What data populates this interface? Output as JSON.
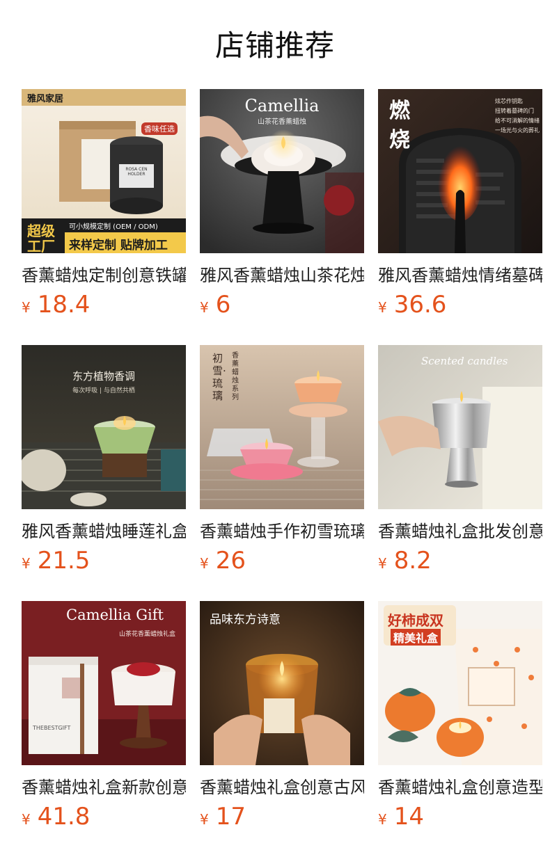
{
  "header": {
    "title": "店铺推荐"
  },
  "products": [
    {
      "name": "香薰蜡烛定制创意铁罐",
      "currency": "¥",
      "price": "18.4",
      "img_text": {
        "brand": "雅风家居",
        "tag": "香味任选",
        "line1": "可小规模定制 (OEM / ODM)",
        "badge1": "超级",
        "badge2": "工厂",
        "banner": "来样定制 贴牌加工",
        "label": "ROSA CEN HOLDER"
      }
    },
    {
      "name": "雅风香薰蜡烛山茶花烛台",
      "currency": "¥",
      "price": "6",
      "img_text": {
        "title": "Camellia",
        "sub": "山茶花香薰蜡烛"
      }
    },
    {
      "name": "雅风香薰蜡烛情绪墓碑",
      "currency": "¥",
      "price": "36.6",
      "img_text": {
        "big1": "燃",
        "big2": "烧",
        "l1": "炫芯作钥匙",
        "l2": "扭转着墓碑的门",
        "l3": "给不可消解的情绪",
        "l4": "一场光与火的葬礼"
      }
    },
    {
      "name": "雅风香薰蜡烛睡莲礼盒",
      "currency": "¥",
      "price": "21.5",
      "img_text": {
        "top": "东方植物香调",
        "sub": "每次呼吸 | 与自然共栖"
      }
    },
    {
      "name": "香薰蜡烛手作初雪琉璃",
      "currency": "¥",
      "price": "26",
      "img_text": {
        "v1": "初雪·琉璃",
        "v2": "香薰蜡烛系列"
      }
    },
    {
      "name": "香薰蜡烛礼盒批发创意",
      "currency": "¥",
      "price": "8.2",
      "img_text": {
        "script": "Scented candles"
      }
    },
    {
      "name": "香薰蜡烛礼盒新款创意",
      "currency": "¥",
      "price": "41.8",
      "img_text": {
        "title": "Camellia Gift",
        "sub": "山茶花香薰蜡烛礼盒",
        "box": "THEBESTGIFT"
      }
    },
    {
      "name": "香薰蜡烛礼盒创意古风",
      "currency": "¥",
      "price": "17",
      "img_text": {
        "top": "品味东方诗意"
      }
    },
    {
      "name": "香薰蜡烛礼盒创意造型",
      "currency": "¥",
      "price": "14",
      "img_text": {
        "l1": "好柿成双",
        "l2": "精美礼盒"
      }
    }
  ]
}
